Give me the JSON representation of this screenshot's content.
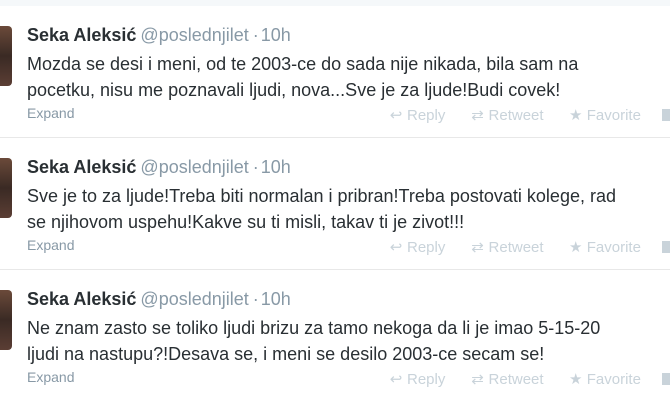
{
  "tweets": [
    {
      "fullname": "Seka Aleksić",
      "username": "@poslednjilet",
      "time": "10h",
      "line1": "Mozda se desi i meni, od te 2003-ce do sada nije nikada, bila sam na",
      "line2": "pocetku, nisu me poznavali ljudi, nova...Sve je za ljude!Budi covek!",
      "expand": "Expand",
      "reply": "Reply",
      "retweet": "Retweet",
      "favorite": "Favorite"
    },
    {
      "fullname": "Seka Aleksić",
      "username": "@poslednjilet",
      "time": "10h",
      "line1": "Sve je to za ljude!Treba biti normalan i pribran!Treba postovati kolege, rad",
      "line2": "se njihovom uspehu!Kakve su ti misli, takav ti je zivot!!!",
      "expand": "Expand",
      "reply": "Reply",
      "retweet": "Retweet",
      "favorite": "Favorite"
    },
    {
      "fullname": "Seka Aleksić",
      "username": "@poslednjilet",
      "time": "10h",
      "line1": "Ne znam zasto se toliko ljudi brizu za tamo nekoga da li je imao 5-15-20",
      "line2": "ljudi na nastupu?!Desava se, i meni se desilo 2003-ce secam se!",
      "expand": "Expand",
      "reply": "Reply",
      "retweet": "Retweet",
      "favorite": "Favorite"
    }
  ],
  "icons": {
    "reply": "reply-arrow-icon",
    "retweet": "retweet-icon",
    "favorite": "star-icon"
  },
  "colors": {
    "name": "#292f33",
    "meta": "#8899a6",
    "actions": "#c9d3da",
    "separator": "#f5f8fa"
  }
}
